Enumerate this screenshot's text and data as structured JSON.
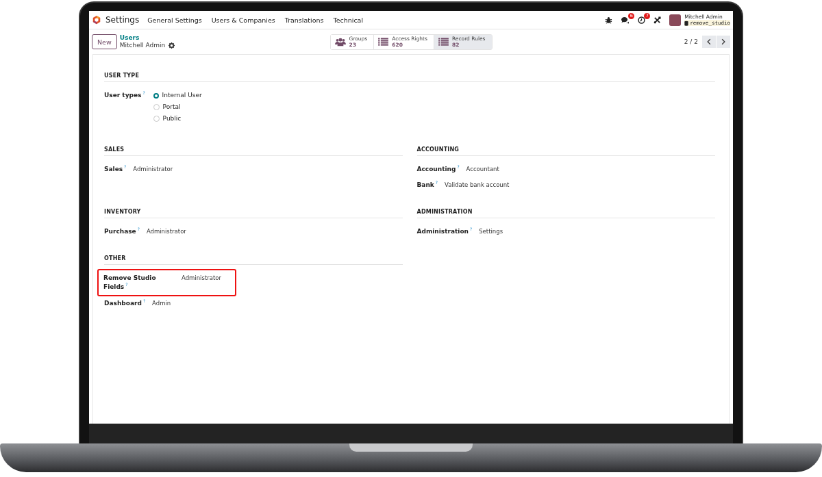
{
  "navbar": {
    "app_name": "Settings",
    "menus": [
      "General Settings",
      "Users & Companies",
      "Translations",
      "Technical"
    ],
    "messages_badge": "6",
    "activities_badge": "7",
    "user_name": "Mitchell Admin",
    "database": "remove_studio"
  },
  "control_panel": {
    "new_button": "New",
    "breadcrumb": "Users",
    "record_name": "Mitchell Admin",
    "stat_buttons": [
      {
        "kind": "groups",
        "label": "Groups",
        "count": "23",
        "selected": false
      },
      {
        "kind": "list",
        "label": "Access Rights",
        "count": "620",
        "selected": false
      },
      {
        "kind": "list",
        "label": "Record Rules",
        "count": "82",
        "selected": true
      }
    ],
    "pager": "2 / 2"
  },
  "user_type": {
    "title": "USER TYPE",
    "label": "User types",
    "help": "?",
    "options": [
      {
        "label": "Internal User",
        "selected": true
      },
      {
        "label": "Portal",
        "selected": false
      },
      {
        "label": "Public",
        "selected": false
      }
    ]
  },
  "sections": [
    {
      "title": "SALES",
      "fields": [
        {
          "label": "Sales",
          "help": "?",
          "value": "Administrator",
          "highlighted": false
        }
      ]
    },
    {
      "title": "ACCOUNTING",
      "fields": [
        {
          "label": "Accounting",
          "help": "?",
          "value": "Accountant",
          "highlighted": false
        },
        {
          "label": "Bank",
          "help": "?",
          "value": "Validate bank account",
          "highlighted": false
        }
      ]
    },
    {
      "title": "INVENTORY",
      "fields": [
        {
          "label": "Purchase",
          "help": "?",
          "value": "Administrator",
          "highlighted": false
        }
      ]
    },
    {
      "title": "ADMINISTRATION",
      "fields": [
        {
          "label": "Administration",
          "help": "?",
          "value": "Settings",
          "highlighted": false
        }
      ]
    },
    {
      "title": "OTHER",
      "fields": [
        {
          "label": "Remove Studio Fields",
          "help": "?",
          "value": "Administrator",
          "highlighted": true
        },
        {
          "label": "Dashboard",
          "help": "?",
          "value": "Admin",
          "highlighted": false
        }
      ]
    }
  ]
}
